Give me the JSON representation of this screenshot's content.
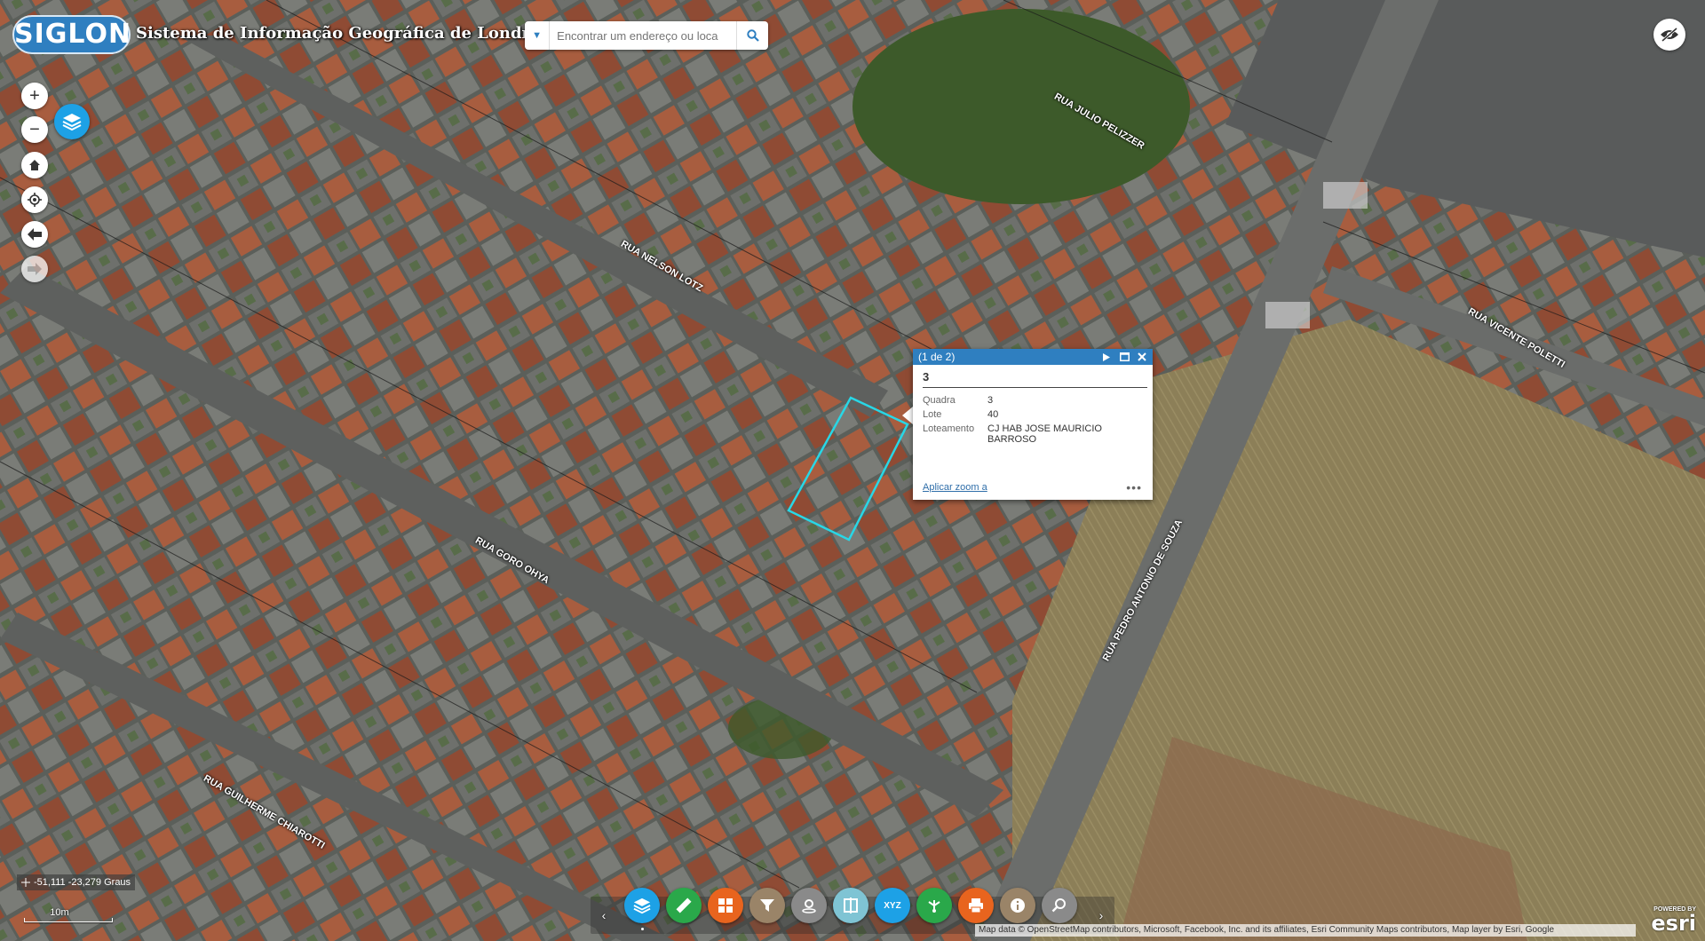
{
  "app": {
    "logo_text": "SIGLON",
    "title": "Sistema de Informação Geográfica de Londrina"
  },
  "search": {
    "placeholder": "Encontrar um endereço ou loca",
    "value": ""
  },
  "streets": [
    {
      "name": "RUA JULIO PELIZZER"
    },
    {
      "name": "RUA NELSON LOTZ"
    },
    {
      "name": "RUA VICENTE POLETTI"
    },
    {
      "name": "RUA GORO OHYA"
    },
    {
      "name": "RUA PEDRO ANTONIO DE SOUZA"
    },
    {
      "name": "RUA GUILHERME CHIAROTTI"
    }
  ],
  "popup": {
    "pager": "(1 de 2)",
    "title": "3",
    "fields": [
      {
        "label": "Quadra",
        "value": "3"
      },
      {
        "label": "Lote",
        "value": "40"
      },
      {
        "label": "Loteamento",
        "value": "CJ HAB JOSE MAURICIO BARROSO"
      }
    ],
    "zoom_link": "Aplicar zoom a",
    "more": "•••"
  },
  "coordinates": "-51,111 -23,279 Graus",
  "scale": "10m",
  "attribution": "Map data © OpenStreetMap contributors, Microsoft, Facebook, Inc. and its affiliates, Esri Community Maps contributors, Map layer by Esri, Google",
  "esri": {
    "powered": "POWERED BY",
    "name": "esri"
  },
  "toolbar": {
    "colors": {
      "layers": "#1da1e6",
      "measure": "#2aa84a",
      "basemap": "#e8641e",
      "filter": "#9a8468",
      "gps": "#8a8a8a",
      "swipe": "#7fc4d4",
      "xyz": "#1da1e6",
      "network": "#2aa84a",
      "print": "#e8641e",
      "info": "#9a8468",
      "zoomsearch": "#8a8a8a"
    },
    "xyz_label": "XYZ"
  },
  "theme": {
    "header_blue": "#2f7fc0",
    "selection_outline": "#28d7e6"
  }
}
